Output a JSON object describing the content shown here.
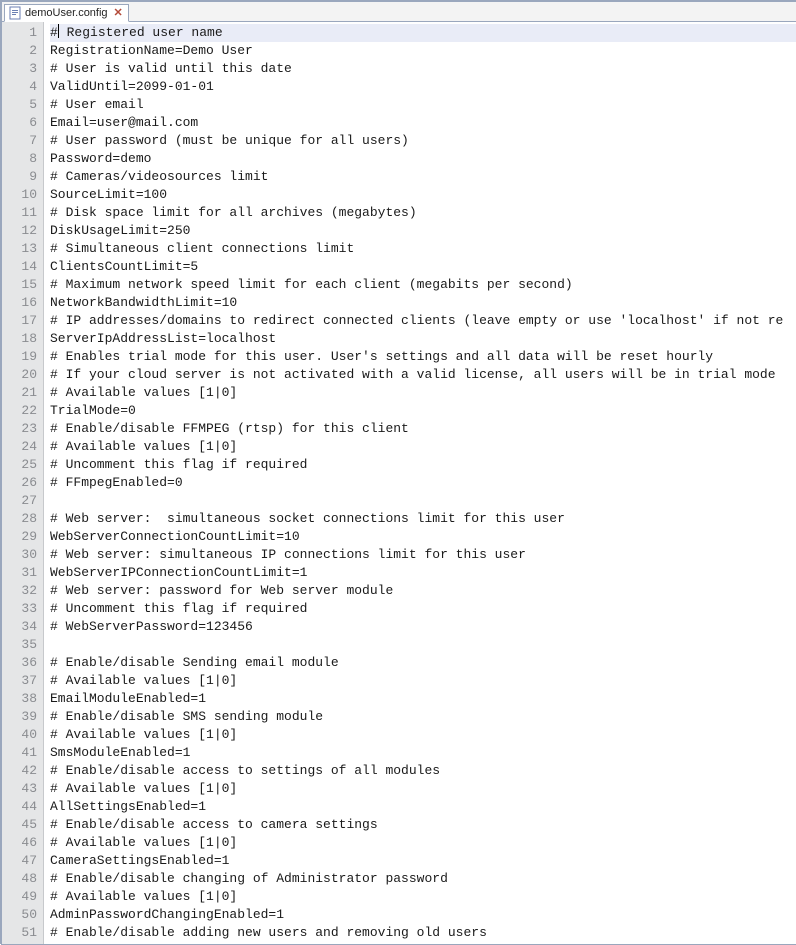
{
  "tab": {
    "filename": "demoUser.config"
  },
  "editor": {
    "highlighted_line_index": 0,
    "lines": [
      "# Registered user name",
      "RegistrationName=Demo User",
      "# User is valid until this date",
      "ValidUntil=2099-01-01",
      "# User email",
      "Email=user@mail.com",
      "# User password (must be unique for all users)",
      "Password=demo",
      "# Cameras/videosources limit",
      "SourceLimit=100",
      "# Disk space limit for all archives (megabytes)",
      "DiskUsageLimit=250",
      "# Simultaneous client connections limit",
      "ClientsCountLimit=5",
      "# Maximum network speed limit for each client (megabits per second)",
      "NetworkBandwidthLimit=10",
      "# IP addresses/domains to redirect connected clients (leave empty or use 'localhost' if not re",
      "ServerIpAddressList=localhost",
      "# Enables trial mode for this user. User's settings and all data will be reset hourly",
      "# If your cloud server is not activated with a valid license, all users will be in trial mode",
      "# Available values [1|0]",
      "TrialMode=0",
      "# Enable/disable FFMPEG (rtsp) for this client",
      "# Available values [1|0]",
      "# Uncomment this flag if required",
      "# FFmpegEnabled=0",
      "",
      "# Web server:  simultaneous socket connections limit for this user",
      "WebServerConnectionCountLimit=10",
      "# Web server: simultaneous IP connections limit for this user",
      "WebServerIPConnectionCountLimit=1",
      "# Web server: password for Web server module",
      "# Uncomment this flag if required",
      "# WebServerPassword=123456",
      "",
      "# Enable/disable Sending email module",
      "# Available values [1|0]",
      "EmailModuleEnabled=1",
      "# Enable/disable SMS sending module",
      "# Available values [1|0]",
      "SmsModuleEnabled=1",
      "# Enable/disable access to settings of all modules",
      "# Available values [1|0]",
      "AllSettingsEnabled=1",
      "# Enable/disable access to camera settings",
      "# Available values [1|0]",
      "CameraSettingsEnabled=1",
      "# Enable/disable changing of Administrator password",
      "# Available values [1|0]",
      "AdminPasswordChangingEnabled=1",
      "# Enable/disable adding new users and removing old users"
    ]
  }
}
